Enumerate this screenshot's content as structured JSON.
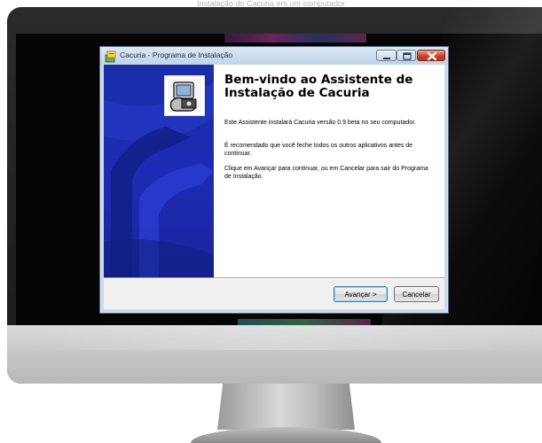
{
  "caption": "Instalação do Cacuria em um computador",
  "installer": {
    "title": "Cacuria - Programa de Instalação",
    "heading": "Bem-vindo ao Assistente de Instalação de Cacuria",
    "paragraphs": [
      "Este Assistente instalará Cacuria versão 0.9 beta no seu computador.",
      "É recomendado que você feche todos os outros aplicativos antes de continuar.",
      "Clique em Avançar para continuar, ou em Cancelar para sair do Programa de Instalação."
    ],
    "buttons": {
      "next": "Avançar >",
      "cancel": "Cancelar"
    },
    "controls": {
      "minimize_icon": "minimize-icon",
      "maximize_icon": "maximize-icon",
      "close_icon": "close-icon"
    }
  },
  "colors": {
    "wizard_sidebar": "#1d2bb4",
    "close_button": "#c9432c",
    "titlebar": "#c9d8ea"
  }
}
